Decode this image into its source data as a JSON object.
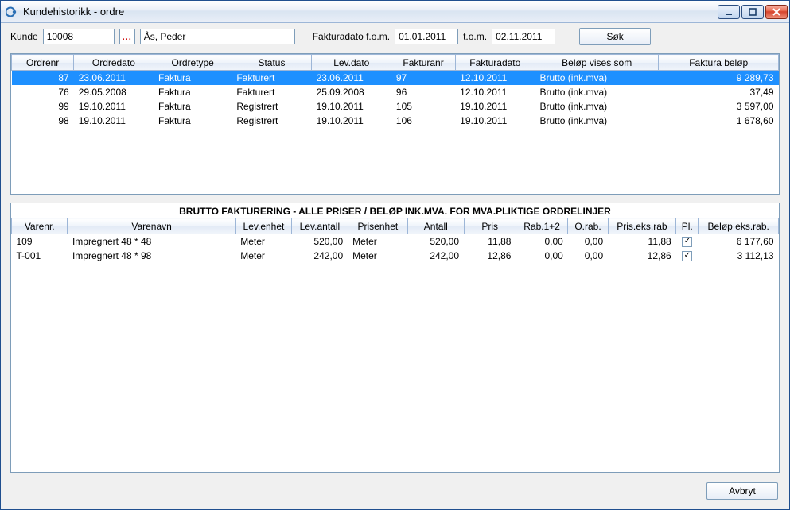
{
  "window": {
    "title": "Kundehistorikk - ordre"
  },
  "form": {
    "kunde_label": "Kunde",
    "kunde_value": "10008",
    "kunde_name": "Ås, Peder",
    "fakturadato_fom_label": "Fakturadato f.o.m.",
    "fakturadato_fom_value": "01.01.2011",
    "tom_label": "t.o.m.",
    "tom_value": "02.11.2011",
    "sok_label": "Søk"
  },
  "orders": {
    "headers": [
      "Ordrenr",
      "Ordredato",
      "Ordretype",
      "Status",
      "Lev.dato",
      "Fakturanr",
      "Fakturadato",
      "Beløp vises som",
      "Faktura beløp"
    ],
    "rows": [
      {
        "selected": true,
        "ordrenr": "87",
        "ordredato": "23.06.2011",
        "ordretype": "Faktura",
        "status": "Fakturert",
        "levdato": "23.06.2011",
        "fakturanr": "97",
        "fakturadato": "12.10.2011",
        "belop_vis": "Brutto (ink.mva)",
        "faktura_belop": "9 289,73"
      },
      {
        "selected": false,
        "ordrenr": "76",
        "ordredato": "29.05.2008",
        "ordretype": "Faktura",
        "status": "Fakturert",
        "levdato": "25.09.2008",
        "fakturanr": "96",
        "fakturadato": "12.10.2011",
        "belop_vis": "Brutto (ink.mva)",
        "faktura_belop": "37,49"
      },
      {
        "selected": false,
        "ordrenr": "99",
        "ordredato": "19.10.2011",
        "ordretype": "Faktura",
        "status": "Registrert",
        "levdato": "19.10.2011",
        "fakturanr": "105",
        "fakturadato": "19.10.2011",
        "belop_vis": "Brutto (ink.mva)",
        "faktura_belop": "3 597,00"
      },
      {
        "selected": false,
        "ordrenr": "98",
        "ordredato": "19.10.2011",
        "ordretype": "Faktura",
        "status": "Registrert",
        "levdato": "19.10.2011",
        "fakturanr": "106",
        "fakturadato": "19.10.2011",
        "belop_vis": "Brutto (ink.mva)",
        "faktura_belop": "1 678,60"
      }
    ]
  },
  "lines": {
    "title": "BRUTTO FAKTURERING - ALLE PRISER / BELØP INK.MVA. FOR MVA.PLIKTIGE ORDRELINJER",
    "headers": [
      "Varenr.",
      "Varenavn",
      "Lev.enhet",
      "Lev.antall",
      "Prisenhet",
      "Antall",
      "Pris",
      "Rab.1+2",
      "O.rab.",
      "Pris.eks.rab",
      "Pl.",
      "Beløp eks.rab."
    ],
    "rows": [
      {
        "varenr": "109",
        "varenavn": "Impregnert 48 * 48",
        "levEnhet": "Meter",
        "levAntall": "520,00",
        "prisenhet": "Meter",
        "antall": "520,00",
        "pris": "11,88",
        "rab12": "0,00",
        "orab": "0,00",
        "prisEksRab": "11,88",
        "pl": true,
        "belopEksRab": "6 177,60"
      },
      {
        "varenr": "T-001",
        "varenavn": "Impregnert 48 * 98",
        "levEnhet": "Meter",
        "levAntall": "242,00",
        "prisenhet": "Meter",
        "antall": "242,00",
        "pris": "12,86",
        "rab12": "0,00",
        "orab": "0,00",
        "prisEksRab": "12,86",
        "pl": true,
        "belopEksRab": "3 112,13"
      }
    ]
  },
  "footer": {
    "avbryt_label": "Avbryt"
  }
}
